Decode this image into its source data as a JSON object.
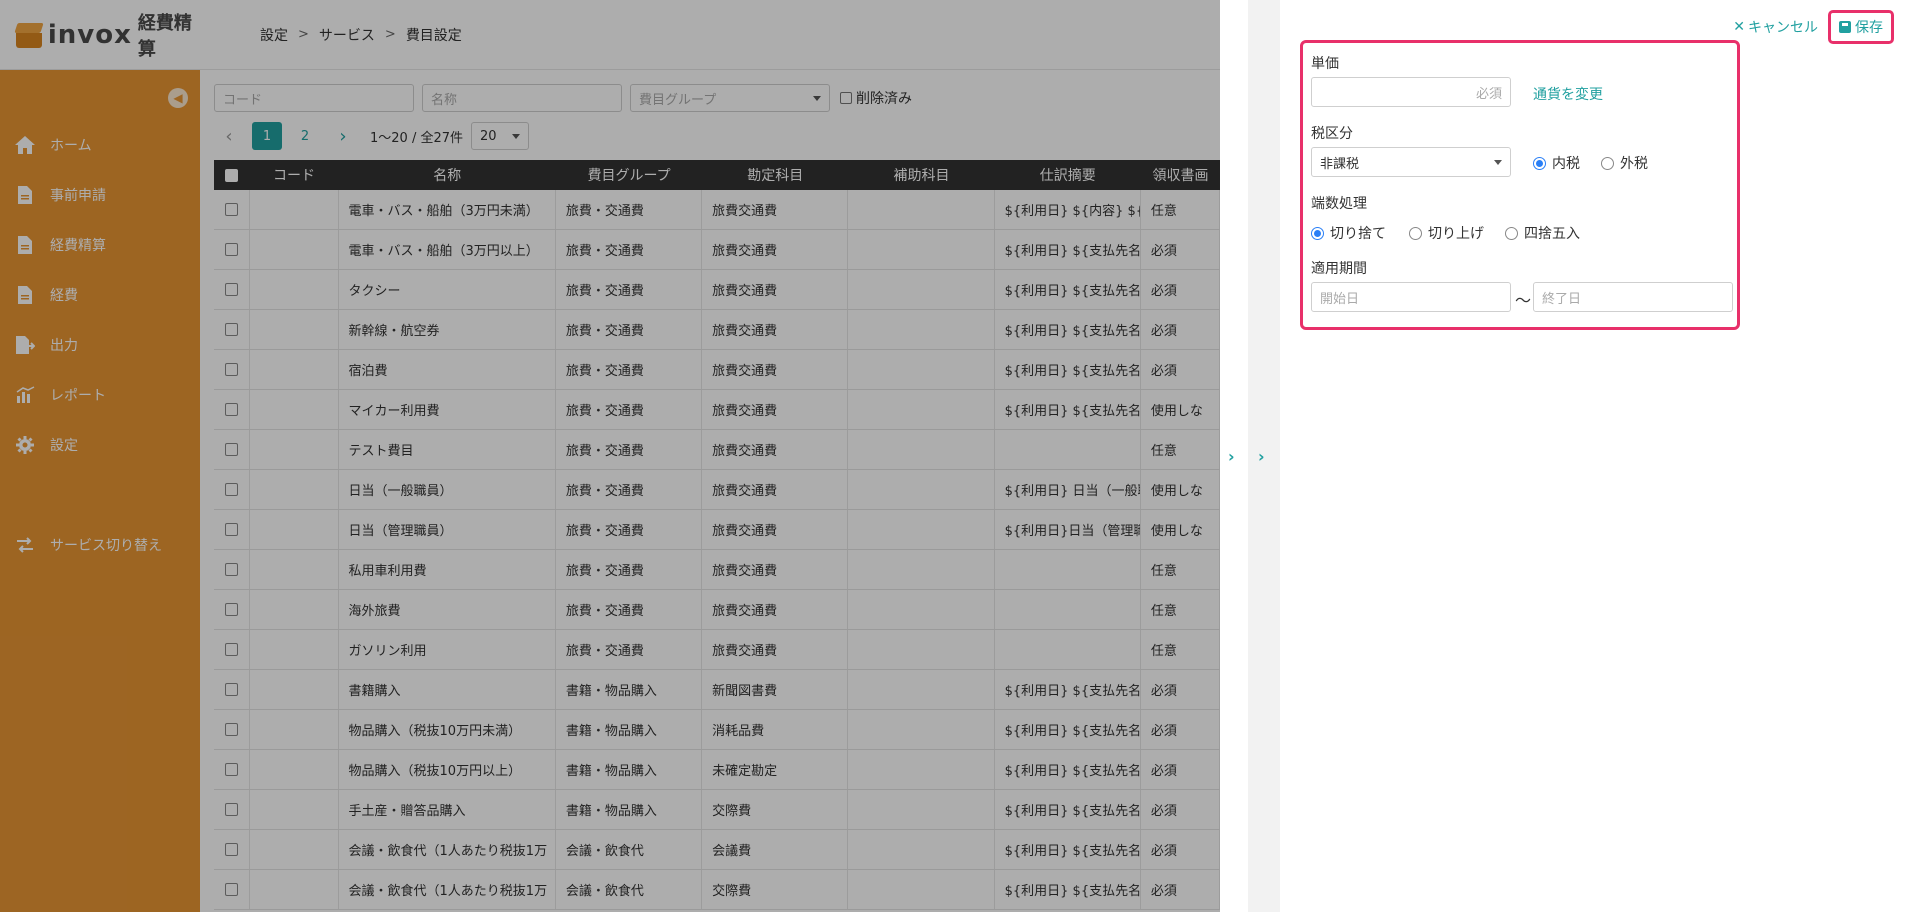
{
  "app": {
    "logo_text": "invox",
    "logo_sub": "経費精算"
  },
  "breadcrumb": [
    "設定",
    "サービス",
    "費目設定"
  ],
  "sidebar": {
    "items": [
      {
        "label": "ホーム",
        "icon": "home-icon"
      },
      {
        "label": "事前申請",
        "icon": "document-icon"
      },
      {
        "label": "経費精算",
        "icon": "document-icon"
      },
      {
        "label": "経費",
        "icon": "document-icon"
      },
      {
        "label": "出力",
        "icon": "export-icon"
      },
      {
        "label": "レポート",
        "icon": "chart-icon"
      },
      {
        "label": "設定",
        "icon": "gear-icon"
      }
    ],
    "switch_label": "サービス切り替え"
  },
  "filters": {
    "code_placeholder": "コード",
    "name_placeholder": "名称",
    "group_placeholder": "費目グループ",
    "deleted_label": "削除済み"
  },
  "pager": {
    "pages": [
      "1",
      "2"
    ],
    "range": "1〜20 / 全27件",
    "per_page": "20"
  },
  "table": {
    "headers": [
      "コード",
      "名称",
      "費目グループ",
      "勘定科目",
      "補助科目",
      "仕訳摘要",
      "領収書画"
    ],
    "rows": [
      {
        "code": "",
        "name": "電車・バス・船舶（3万円未満）",
        "group": "旅費・交通費",
        "account": "旅費交通費",
        "sub": "",
        "memo": "${利用日} ${内容} ${片",
        "receipt": "任意"
      },
      {
        "code": "",
        "name": "電車・バス・船舶（3万円以上）",
        "group": "旅費・交通費",
        "account": "旅費交通費",
        "sub": "",
        "memo": "${利用日} ${支払先名}",
        "receipt": "必須"
      },
      {
        "code": "",
        "name": "タクシー",
        "group": "旅費・交通費",
        "account": "旅費交通費",
        "sub": "",
        "memo": "${利用日} ${支払先名}",
        "receipt": "必須"
      },
      {
        "code": "",
        "name": "新幹線・航空券",
        "group": "旅費・交通費",
        "account": "旅費交通費",
        "sub": "",
        "memo": "${利用日} ${支払先名}",
        "receipt": "必須"
      },
      {
        "code": "",
        "name": "宿泊費",
        "group": "旅費・交通費",
        "account": "旅費交通費",
        "sub": "",
        "memo": "${利用日} ${支払先名}",
        "receipt": "必須"
      },
      {
        "code": "",
        "name": "マイカー利用費",
        "group": "旅費・交通費",
        "account": "旅費交通費",
        "sub": "",
        "memo": "${利用日} ${支払先名}",
        "receipt": "使用しな"
      },
      {
        "code": "",
        "name": "テスト費目",
        "group": "旅費・交通費",
        "account": "旅費交通費",
        "sub": "",
        "memo": "",
        "receipt": "任意"
      },
      {
        "code": "",
        "name": "日当（一般職員）",
        "group": "旅費・交通費",
        "account": "旅費交通費",
        "sub": "",
        "memo": "${利用日} 日当（一般職",
        "receipt": "使用しな"
      },
      {
        "code": "",
        "name": "日当（管理職員）",
        "group": "旅費・交通費",
        "account": "旅費交通費",
        "sub": "",
        "memo": "${利用日}日当（管理職",
        "receipt": "使用しな"
      },
      {
        "code": "",
        "name": "私用車利用費",
        "group": "旅費・交通費",
        "account": "旅費交通費",
        "sub": "",
        "memo": "",
        "receipt": "任意"
      },
      {
        "code": "",
        "name": "海外旅費",
        "group": "旅費・交通費",
        "account": "旅費交通費",
        "sub": "",
        "memo": "",
        "receipt": "任意"
      },
      {
        "code": "",
        "name": "ガソリン利用",
        "group": "旅費・交通費",
        "account": "旅費交通費",
        "sub": "",
        "memo": "",
        "receipt": "任意"
      },
      {
        "code": "",
        "name": "書籍購入",
        "group": "書籍・物品購入",
        "account": "新聞図書費",
        "sub": "",
        "memo": "${利用日} ${支払先名}",
        "receipt": "必須"
      },
      {
        "code": "",
        "name": "物品購入（税抜10万円未満）",
        "group": "書籍・物品購入",
        "account": "消耗品費",
        "sub": "",
        "memo": "${利用日} ${支払先名}",
        "receipt": "必須"
      },
      {
        "code": "",
        "name": "物品購入（税抜10万円以上）",
        "group": "書籍・物品購入",
        "account": "未確定勘定",
        "sub": "",
        "memo": "${利用日} ${支払先名}",
        "receipt": "必須"
      },
      {
        "code": "",
        "name": "手土産・贈答品購入",
        "group": "書籍・物品購入",
        "account": "交際費",
        "sub": "",
        "memo": "${利用日} ${支払先名}",
        "receipt": "必須"
      },
      {
        "code": "",
        "name": "会議・飲食代（1人あたり税抜1万",
        "group": "会議・飲食代",
        "account": "会議費",
        "sub": "",
        "memo": "${利用日} ${支払先名}",
        "receipt": "必須"
      },
      {
        "code": "",
        "name": "会議・飲食代（1人あたり税抜1万",
        "group": "会議・飲食代",
        "account": "交際費",
        "sub": "",
        "memo": "${利用日} ${支払先名}",
        "receipt": "必須"
      }
    ]
  },
  "panel": {
    "cancel_label": "キャンセル",
    "save_label": "保存",
    "unit_price_label": "単価",
    "unit_price_placeholder": "必須",
    "currency_link": "通貨を変更",
    "tax_label": "税区分",
    "tax_value": "非課税",
    "tax_inclusive": "内税",
    "tax_exclusive": "外税",
    "rounding_label": "端数処理",
    "rounding_options": [
      "切り捨て",
      "切り上げ",
      "四捨五入"
    ],
    "period_label": "適用期間",
    "start_placeholder": "開始日",
    "end_placeholder": "終了日",
    "tilde": "〜"
  },
  "colors": {
    "sidebar": "#e79533",
    "accent": "#21a0a0",
    "highlight": "#e8306a"
  }
}
